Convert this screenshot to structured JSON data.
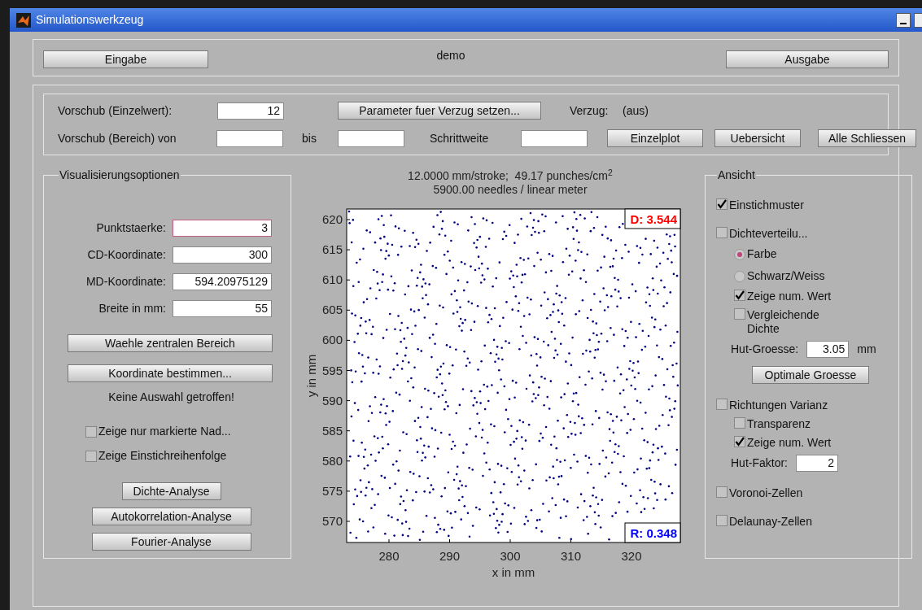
{
  "window": {
    "title": "Simulationswerkzeug"
  },
  "top_panel": {
    "left_button": "Eingabe",
    "label": "demo",
    "right_button": "Ausgabe"
  },
  "parameter_rows": [
    [
      {
        "kind": "label",
        "text": "Vorschub (Einzelwert):"
      },
      {
        "kind": "field",
        "value": "12"
      },
      {
        "kind": "button",
        "text": "Parameter fuer Verzug setzen..."
      },
      {
        "kind": "label",
        "text": "Verzug:"
      },
      {
        "kind": "label",
        "text": "(aus)"
      }
    ],
    [
      {
        "kind": "label",
        "text": "Vorschub (Bereich) von"
      },
      {
        "kind": "field"
      },
      {
        "kind": "label",
        "text": "bis"
      },
      {
        "kind": "field"
      },
      {
        "kind": "label",
        "text": "Schrittweite"
      },
      {
        "kind": "field"
      },
      {
        "kind": "button",
        "text": "Einzelplot"
      },
      {
        "kind": "button",
        "text": "Uebersicht"
      },
      {
        "kind": "button",
        "text": "Alle Schliessen"
      }
    ]
  ],
  "visualization": {
    "title": "Visualisierungsoptionen",
    "fields": [
      {
        "label": "Punktstaerke:",
        "value": "3",
        "focused": true
      },
      {
        "label": "CD-Koordinate:",
        "value": "300",
        "focused": false
      },
      {
        "label": "MD-Koordinate:",
        "value": "594.20975129",
        "focused": false
      },
      {
        "label": "Breite in mm:",
        "value": "55",
        "focused": false
      }
    ],
    "buttons": [
      "Waehle zentralen Bereich",
      "Koordinate bestimmen..."
    ],
    "status": "Keine Auswahl getroffen!",
    "checkboxes": [
      {
        "label": "Zeige nur markierte Nad...",
        "checked": false
      },
      {
        "label": "Zeige Einstichreihenfolge",
        "checked": false
      }
    ],
    "analysis_buttons": [
      "Dichte-Analyse",
      "Autokorrelation-Analyse",
      "Fourier-Analyse"
    ]
  },
  "plot": {
    "title": "12.0000 mm/stroke;  49.17 punches/cm$^{2}$",
    "subtitle": "5900.00 needles / linear meter",
    "xlabel": "x in mm",
    "ylabel": "y in mm",
    "xticks": [
      "280",
      "290",
      "300",
      "310",
      "320"
    ],
    "yticks": [
      "620",
      "615",
      "610",
      "605",
      "600",
      "595",
      "590",
      "585",
      "580",
      "575",
      "570"
    ],
    "annotations": [
      {
        "text": "D: 3.544",
        "color": "#ff0000"
      },
      {
        "text": "R: 0.348",
        "color": "#0000ff"
      }
    ]
  },
  "view": {
    "title": "Ansicht",
    "items": [
      {
        "kind": "checkbox",
        "label": "Einstichmuster",
        "checked": true
      },
      {
        "kind": "checkbox",
        "label": "Dichteverteilu...",
        "checked": false,
        "children": [
          {
            "kind": "radio",
            "label": "Farbe",
            "selected": true
          },
          {
            "kind": "radio",
            "label": "Schwarz/Weiss",
            "selected": false
          },
          {
            "kind": "checkbox",
            "label": "Zeige num. Wert",
            "checked": true
          },
          {
            "kind": "checkbox",
            "label": "Vergleichende Dichte",
            "checked": false
          },
          {
            "kind": "field",
            "label": "Hut-Groesse:",
            "value": "3.05",
            "unit": "mm"
          },
          {
            "kind": "button",
            "label": "Optimale Groesse"
          }
        ]
      },
      {
        "kind": "checkbox",
        "label": "Richtungen Varianz",
        "checked": false,
        "children": [
          {
            "kind": "checkbox",
            "label": "Transparenz",
            "checked": false
          },
          {
            "kind": "checkbox",
            "label": "Zeige num. Wert",
            "checked": true
          },
          {
            "kind": "field",
            "label": "Hut-Faktor:",
            "value": "2"
          }
        ]
      },
      {
        "kind": "checkbox",
        "label": "Voronoi-Zellen",
        "checked": false
      },
      {
        "kind": "checkbox",
        "label": "Delaunay-Zellen",
        "checked": false
      }
    ]
  }
}
